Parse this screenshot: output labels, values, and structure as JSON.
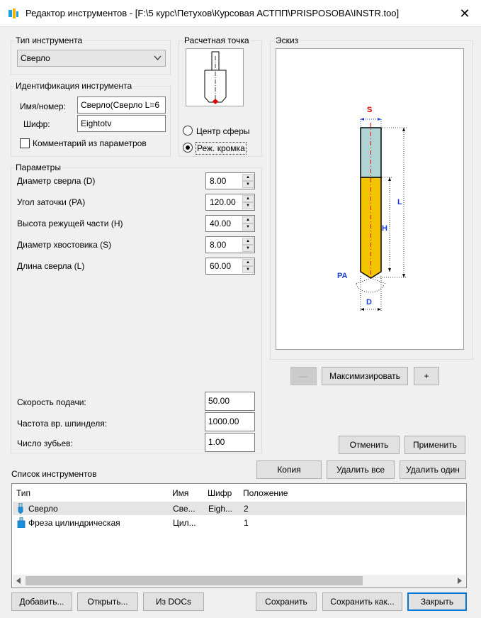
{
  "window": {
    "title": "Редактор инструментов - [F:\\5 курс\\Петухов\\Курсовая АСТПП\\PRISPOSOBA\\INSTR.too]",
    "close_glyph": "✕"
  },
  "tool_type": {
    "label": "Тип инструмента",
    "value": "Сверло"
  },
  "identification": {
    "label": "Идентификация инструмента",
    "name_label": "Имя/номер:",
    "name_value": "Сверло(Сверло L=6",
    "code_label": "Шифр:",
    "code_value": "Eightotv",
    "comment_checkbox": "Комментарий из параметров",
    "comment_checked": false
  },
  "calc_point": {
    "label": "Расчетная точка",
    "option_sphere": "Центр сферы",
    "option_edge": "Реж. кромка",
    "selected": "edge"
  },
  "sketch": {
    "label": "Эскиз",
    "dim_s": "S",
    "dim_l": "L",
    "dim_h": "H",
    "dim_pa": "PA",
    "dim_d": "D",
    "colors": {
      "shank": "#b0d4d4",
      "cutting": "#f5c400",
      "dim": "#1a3fd8",
      "accent": "#e00000"
    }
  },
  "sketch_buttons": {
    "minimize": "—",
    "maximize": "Максимизировать",
    "plus": "+"
  },
  "params": {
    "label": "Параметры",
    "rows": [
      {
        "label": "Диаметр сверла (D)",
        "value": "8.00"
      },
      {
        "label": "Угол заточки (PA)",
        "value": "120.00"
      },
      {
        "label": "Высота режущей части (H)",
        "value": "40.00"
      },
      {
        "label": "Диаметр хвостовика (S)",
        "value": "8.00"
      },
      {
        "label": "Длина сверла (L)",
        "value": "60.00"
      }
    ],
    "feed_label": "Скорость подачи:",
    "feed_value": "50.00",
    "spindle_label": "Частота вр. шпинделя:",
    "spindle_value": "1000.00",
    "teeth_label": "Число зубьев:",
    "teeth_value": "1.00"
  },
  "apply_buttons": {
    "cancel": "Отменить",
    "apply": "Применить"
  },
  "tool_list": {
    "label": "Список инструментов",
    "copy": "Копия",
    "delete_all": "Удалить все",
    "delete_one": "Удалить один",
    "columns": [
      "Тип",
      "Имя",
      "Шифр",
      "Положение"
    ],
    "rows": [
      {
        "type": "Сверло",
        "name": "Све...",
        "code": "Eigh...",
        "pos": "2",
        "icon": "drill-icon"
      },
      {
        "type": "Фреза цилиндрическая",
        "name": "Цил...",
        "code": "",
        "pos": "1",
        "icon": "mill-icon"
      }
    ]
  },
  "bottom_buttons": {
    "add": "Добавить...",
    "open": "Открыть...",
    "from_docs": "Из DOCs",
    "save": "Сохранить",
    "save_as": "Сохранить как...",
    "close": "Закрыть"
  }
}
